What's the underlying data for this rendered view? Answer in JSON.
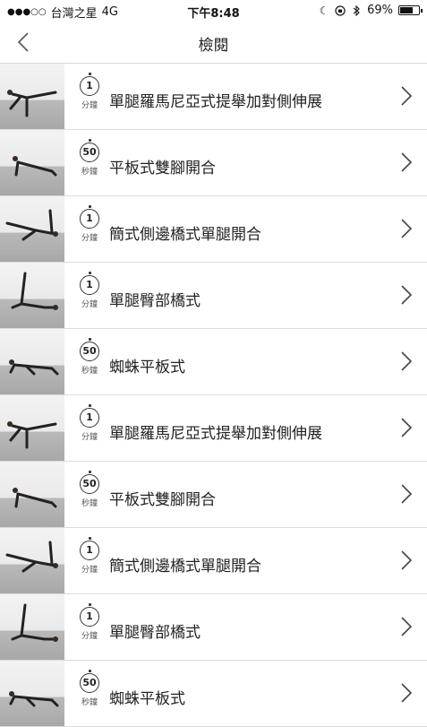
{
  "status_bar": {
    "carrier": "台灣之星",
    "network": "4G",
    "time": "下午8:48",
    "battery": "69%"
  },
  "nav": {
    "title": "檢閱"
  },
  "items": [
    {
      "value": "1",
      "unit": "分鐘",
      "title": "單腿羅馬尼亞式提舉加對側伸展"
    },
    {
      "value": "50",
      "unit": "秒鐘",
      "title": "平板式雙腳開合"
    },
    {
      "value": "1",
      "unit": "分鐘",
      "title": "簡式側邊橋式單腿開合"
    },
    {
      "value": "1",
      "unit": "分鐘",
      "title": "單腿臀部橋式"
    },
    {
      "value": "50",
      "unit": "秒鐘",
      "title": "蜘蛛平板式"
    },
    {
      "value": "1",
      "unit": "分鐘",
      "title": "單腿羅馬尼亞式提舉加對側伸展"
    },
    {
      "value": "50",
      "unit": "秒鐘",
      "title": "平板式雙腳開合"
    },
    {
      "value": "1",
      "unit": "分鐘",
      "title": "簡式側邊橋式單腿開合"
    },
    {
      "value": "1",
      "unit": "分鐘",
      "title": "單腿臀部橋式"
    },
    {
      "value": "50",
      "unit": "秒鐘",
      "title": "蜘蛛平板式"
    }
  ]
}
